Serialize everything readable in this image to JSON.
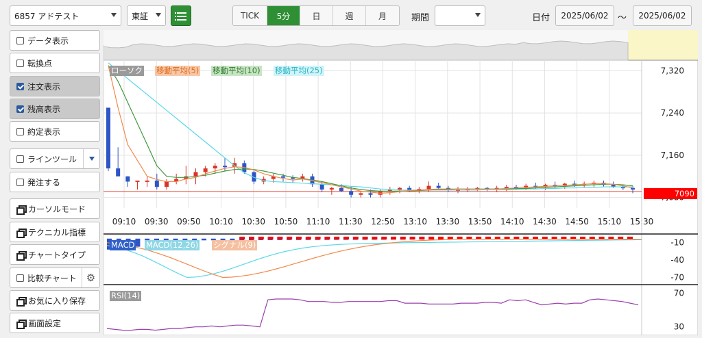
{
  "toolbar": {
    "stock": "6857 アドテスト",
    "market": "東証",
    "list_icon": "list-icon",
    "intervals": [
      "TICK",
      "5分",
      "日",
      "週",
      "月"
    ],
    "active_interval": "5分",
    "period_label": "期間",
    "period_value": "",
    "date_label": "日付",
    "date_from": "2025/06/02",
    "date_sep": "～",
    "date_to": "2025/06/02"
  },
  "sidebar": {
    "data_view": "データ表示",
    "reversal": "転換点",
    "order_view": "注文表示",
    "position_view": "残高表示",
    "execution_view": "約定表示",
    "line_tool": "ラインツール",
    "order_entry": "発注する",
    "cursor_mode": "カーソルモード",
    "technical": "テクニカル指標",
    "chart_type": "チャートタイプ",
    "compare": "比較チャート",
    "save_favorite": "お気に入り保存",
    "screen_settings": "画面設定"
  },
  "colors": {
    "accent": "#2f8f35",
    "up": "#d9342b",
    "down": "#2e55c6",
    "price_tag": "#ff0000",
    "ma5": "#f2884a",
    "ma10": "#3f9a3f",
    "ma25": "#5ad8e8",
    "rsi": "#9a3fae"
  },
  "chart_data": [
    {
      "type": "candlestick",
      "legend": [
        "ローソク",
        "移動平均(5)",
        "移動平均(10)",
        "移動平均(25)"
      ],
      "x_ticks": [
        "09:10",
        "09:30",
        "09:50",
        "10:10",
        "10:30",
        "10:50",
        "11:10",
        "11:30",
        "12:50",
        "13:10",
        "13:30",
        "13:50",
        "14:10",
        "14:30",
        "14:50",
        "15:10",
        "15:30"
      ],
      "y_ticks": [
        "7,320",
        "7,240",
        "7,160",
        "7,080"
      ],
      "ylim": [
        7060,
        7340
      ],
      "current_price": "7090",
      "candles": [
        [
          7250,
          7250,
          7130,
          7135
        ],
        [
          7135,
          7175,
          7120,
          7120
        ],
        [
          7120,
          7120,
          7100,
          7110
        ],
        [
          7110,
          7110,
          7095,
          7112
        ],
        [
          7112,
          7120,
          7100,
          7112
        ],
        [
          7112,
          7125,
          7095,
          7100
        ],
        [
          7100,
          7115,
          7095,
          7110
        ],
        [
          7110,
          7125,
          7105,
          7115
        ],
        [
          7115,
          7140,
          7105,
          7120
        ],
        [
          7120,
          7135,
          7105,
          7128
        ],
        [
          7128,
          7140,
          7120,
          7135
        ],
        [
          7135,
          7145,
          7125,
          7140
        ],
        [
          7140,
          7155,
          7130,
          7138
        ],
        [
          7138,
          7155,
          7125,
          7145
        ],
        [
          7145,
          7150,
          7125,
          7128
        ],
        [
          7128,
          7130,
          7105,
          7110
        ],
        [
          7110,
          7120,
          7105,
          7115
        ],
        [
          7115,
          7125,
          7108,
          7120
        ],
        [
          7120,
          7125,
          7110,
          7118
        ],
        [
          7118,
          7122,
          7108,
          7116
        ],
        [
          7116,
          7125,
          7110,
          7120
        ],
        [
          7120,
          7125,
          7100,
          7105
        ],
        [
          7105,
          7110,
          7090,
          7095
        ],
        [
          7095,
          7100,
          7085,
          7098
        ],
        [
          7098,
          7105,
          7090,
          7092
        ],
        [
          7092,
          7100,
          7080,
          7085
        ],
        [
          7085,
          7092,
          7080,
          7088
        ],
        [
          7088,
          7095,
          7080,
          7085
        ],
        [
          7085,
          7095,
          7080,
          7092
        ],
        [
          7092,
          7100,
          7085,
          7095
        ],
        [
          7095,
          7100,
          7088,
          7098
        ],
        [
          7098,
          7102,
          7090,
          7094
        ],
        [
          7094,
          7100,
          7088,
          7096
        ],
        [
          7096,
          7110,
          7090,
          7102
        ],
        [
          7102,
          7108,
          7094,
          7098
        ],
        [
          7098,
          7102,
          7090,
          7094
        ],
        [
          7094,
          7100,
          7088,
          7095
        ],
        [
          7095,
          7100,
          7090,
          7096
        ],
        [
          7096,
          7100,
          7092,
          7098
        ],
        [
          7098,
          7100,
          7092,
          7095
        ],
        [
          7095,
          7102,
          7090,
          7098
        ],
        [
          7098,
          7104,
          7092,
          7100
        ],
        [
          7100,
          7104,
          7094,
          7098
        ],
        [
          7098,
          7106,
          7094,
          7102
        ],
        [
          7102,
          7108,
          7096,
          7100
        ],
        [
          7100,
          7106,
          7094,
          7104
        ],
        [
          7104,
          7110,
          7098,
          7102
        ],
        [
          7102,
          7108,
          7096,
          7106
        ],
        [
          7106,
          7112,
          7100,
          7104
        ],
        [
          7104,
          7110,
          7098,
          7106
        ],
        [
          7106,
          7112,
          7100,
          7108
        ],
        [
          7108,
          7112,
          7100,
          7104
        ],
        [
          7104,
          7110,
          7098,
          7100
        ],
        [
          7100,
          7104,
          7094,
          7098
        ],
        [
          7098,
          7102,
          7088,
          7095
        ]
      ],
      "ma5": [
        7330,
        7250,
        7180,
        7150,
        7120,
        7114,
        7110,
        7110,
        7115,
        7118,
        7125,
        7130,
        7135,
        7138,
        7137,
        7132,
        7125,
        7120,
        7116,
        7113,
        7115,
        7112,
        7108,
        7104,
        7100,
        7096,
        7092,
        7090,
        7088,
        7089,
        7091,
        7093,
        7094,
        7095,
        7096,
        7096,
        7096,
        7096,
        7096,
        7096,
        7096,
        7097,
        7098,
        7099,
        7100,
        7101,
        7102,
        7103,
        7104,
        7105,
        7106,
        7106,
        7105,
        7102,
        7098
      ],
      "ma10": [
        7330,
        7300,
        7260,
        7220,
        7180,
        7140,
        7120,
        7118,
        7118,
        7120,
        7122,
        7126,
        7130,
        7133,
        7134,
        7133,
        7130,
        7126,
        7122,
        7118,
        7116,
        7113,
        7110,
        7106,
        7102,
        7098,
        7095,
        7093,
        7092,
        7092,
        7092,
        7092,
        7093,
        7094,
        7095,
        7095,
        7096,
        7096,
        7096,
        7096,
        7096,
        7096,
        7097,
        7097,
        7098,
        7099,
        7100,
        7101,
        7102,
        7103,
        7104,
        7105,
        7105,
        7104,
        7102
      ],
      "ma25": [
        7335,
        7320,
        7305,
        7290,
        7275,
        7260,
        7245,
        7230,
        7215,
        7200,
        7185,
        7170,
        7155,
        7140,
        7127,
        7118,
        7112,
        7110,
        7109,
        7108,
        7107,
        7106,
        7105,
        7104,
        7103,
        7101,
        7100,
        7098,
        7096,
        7095,
        7094,
        7094,
        7094,
        7094,
        7094,
        7094,
        7094,
        7094,
        7094,
        7095,
        7095,
        7095,
        7095,
        7096,
        7096,
        7097,
        7097,
        7098,
        7098,
        7099,
        7099,
        7100,
        7100,
        7100,
        7100
      ]
    },
    {
      "type": "bar+line",
      "legend": [
        "MACD",
        "MACD(12,26)",
        "シグナル(9)"
      ],
      "y_ticks": [
        "-10",
        "-40",
        "-70"
      ],
      "ylim": [
        -80,
        5
      ]
    },
    {
      "type": "line",
      "legend": [
        "RSI(14)"
      ],
      "y_ticks": [
        "70",
        "30"
      ],
      "ylim": [
        20,
        80
      ],
      "values": [
        28,
        27,
        26,
        26,
        27,
        27,
        26,
        27,
        28,
        28,
        29,
        30,
        30,
        31,
        30,
        31,
        32,
        32,
        31,
        30,
        62,
        63,
        63,
        63,
        62,
        60,
        60,
        60,
        59,
        59,
        60,
        60,
        60,
        60,
        60,
        61,
        61,
        58,
        58,
        58,
        57,
        57,
        57,
        57,
        58,
        58,
        58,
        59,
        59,
        58,
        62,
        61,
        62,
        59,
        56,
        57,
        58,
        57,
        58,
        58,
        62,
        63,
        62,
        61,
        60,
        58,
        56
      ]
    }
  ]
}
